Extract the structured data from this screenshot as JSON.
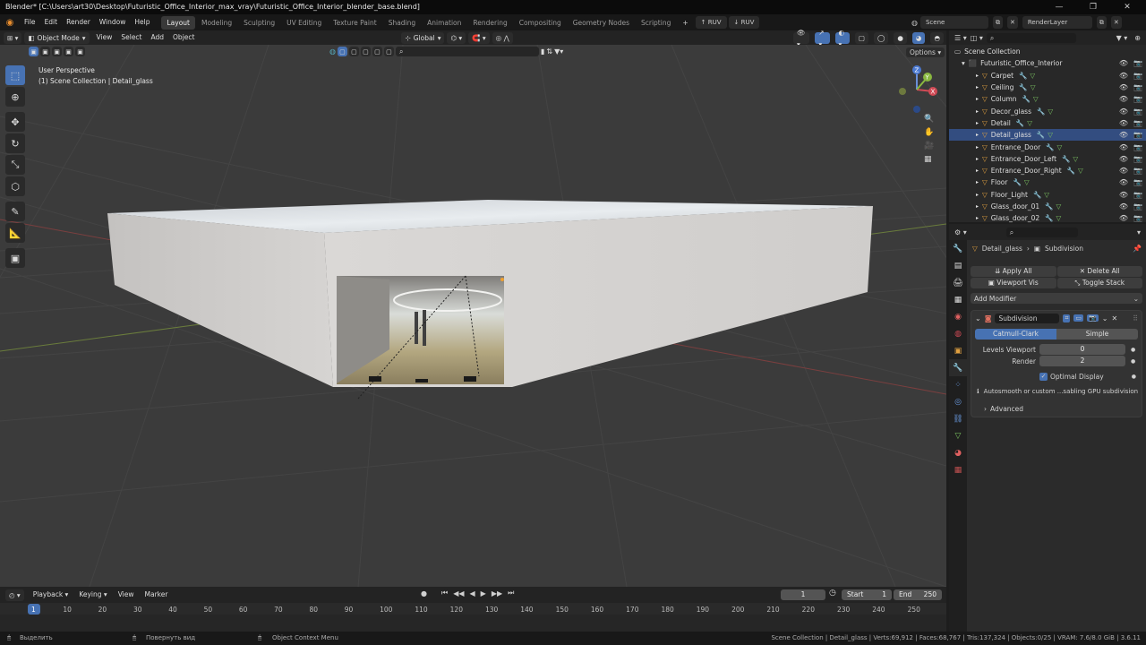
{
  "window": {
    "title": "Blender* [C:\\Users\\art30\\Desktop\\Futuristic_Office_Interior_max_vray\\Futuristic_Office_Interior_blender_base.blend]",
    "controls": [
      "—",
      "❐",
      "✕"
    ]
  },
  "menu": [
    "File",
    "Edit",
    "Render",
    "Window",
    "Help"
  ],
  "workspaces": [
    "Layout",
    "Modeling",
    "Sculpting",
    "UV Editing",
    "Texture Paint",
    "Shading",
    "Animation",
    "Rendering",
    "Compositing",
    "Geometry Nodes",
    "Scripting"
  ],
  "workspace_add": "+",
  "addon_buttons": [
    "RUV",
    "RUV"
  ],
  "scene": {
    "label": "Scene",
    "render_layer": "RenderLayer"
  },
  "viewport_header": {
    "mode": "Object Mode",
    "menus": [
      "View",
      "Select",
      "Add",
      "Object"
    ],
    "orientation": "Global",
    "options_label": "Options"
  },
  "viewport": {
    "perspective": "User Perspective",
    "collection_info": "(1) Scene Collection | Detail_glass",
    "gizmo_axes": [
      "X",
      "Y",
      "Z"
    ]
  },
  "tools": [
    "select-box",
    "cursor",
    "move",
    "rotate",
    "scale",
    "transform",
    "annotate",
    "measure",
    "add-cube"
  ],
  "tool_glyphs": [
    "⬚",
    "⊕",
    "✥",
    "↻",
    "⤡",
    "⬡",
    "✎",
    "📐",
    "▣"
  ],
  "nav_glyphs": [
    "🔍",
    "✋",
    "🎥",
    "▦"
  ],
  "outliner": {
    "root": "Scene Collection",
    "collection": "Futuristic_Office_Interior",
    "items": [
      {
        "name": "Carpet",
        "selected": false
      },
      {
        "name": "Ceiling",
        "selected": false
      },
      {
        "name": "Column",
        "selected": false
      },
      {
        "name": "Decor_glass",
        "selected": false
      },
      {
        "name": "Detail",
        "selected": false
      },
      {
        "name": "Detail_glass",
        "selected": true
      },
      {
        "name": "Entrance_Door",
        "selected": false
      },
      {
        "name": "Entrance_Door_Left",
        "selected": false
      },
      {
        "name": "Entrance_Door_Right",
        "selected": false
      },
      {
        "name": "Floor",
        "selected": false
      },
      {
        "name": "Floor_Light",
        "selected": false
      },
      {
        "name": "Glass_door_01",
        "selected": false
      },
      {
        "name": "Glass_door_02",
        "selected": false
      }
    ]
  },
  "properties": {
    "object": "Detail_glass",
    "modifier_label": "Subdivision",
    "apply_all": "Apply All",
    "delete_all": "Delete All",
    "viewport_vis": "Viewport Vis",
    "toggle_stack": "Toggle Stack",
    "add_modifier": "Add Modifier",
    "modifier_name": "Subdivision",
    "types": [
      "Catmull-Clark",
      "Simple"
    ],
    "levels_viewport_label": "Levels Viewport",
    "levels_viewport": "0",
    "render_label": "Render",
    "render_value": "2",
    "optimal_display": "Optimal Display",
    "info": "Autosmooth or custom ...sabling GPU subdivision",
    "advanced": "Advanced"
  },
  "timeline": {
    "menus": [
      "Playback",
      "Keying",
      "View",
      "Marker"
    ],
    "current_frame": "1",
    "start_label": "Start",
    "start": "1",
    "end_label": "End",
    "end": "250",
    "ticks": [
      "1",
      "10",
      "20",
      "30",
      "40",
      "50",
      "60",
      "70",
      "80",
      "90",
      "100",
      "110",
      "120",
      "130",
      "140",
      "150",
      "160",
      "170",
      "180",
      "190",
      "200",
      "210",
      "220",
      "230",
      "240",
      "250"
    ],
    "playback_glyphs": [
      "⏮",
      "◀◀",
      "◀",
      "▶",
      "▶▶",
      "⏭"
    ]
  },
  "statusbar": {
    "select": "Выделить",
    "rotate": "Повернуть вид",
    "context": "Object Context Menu",
    "stats": "Scene Collection | Detail_glass | Verts:69,912 | Faces:68,767 | Tris:137,324 | Objects:0/25 | VRAM: 7.6/8.0 GiB | 3.6.11"
  }
}
